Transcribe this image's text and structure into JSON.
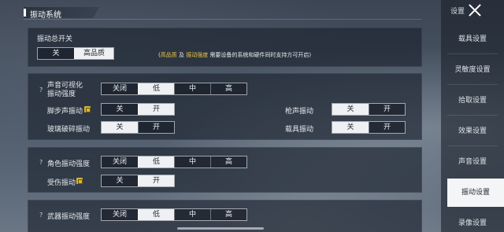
{
  "header": {
    "title": "振动系统"
  },
  "nav": {
    "top_label": "设置",
    "items": [
      "载具设置",
      "灵敏度设置",
      "拾取设置",
      "效果设置",
      "声音设置",
      "振动设置",
      "录像设置"
    ],
    "active": "振动设置"
  },
  "master": {
    "label": "振动总开关",
    "options": [
      "关",
      "高品质"
    ],
    "selected": "高品质",
    "note_open": "(",
    "note_hl1": "高品质",
    "note_mid1": "及",
    "note_hl2": "振动强度",
    "note_rest": "需要设备的系统和硬件同时支持方可开启)"
  },
  "sound": {
    "question": "?",
    "visual_label_line1": "声音可视化",
    "visual_label_line2": "振动强度",
    "intensity_options": [
      "关闭",
      "低",
      "中",
      "高"
    ],
    "intensity_selected": "低",
    "footstep_label": "脚步声振动",
    "footstep_options": [
      "关",
      "开"
    ],
    "footstep_selected": "开",
    "gunshot_label": "枪声振动",
    "gunshot_options": [
      "关",
      "开"
    ],
    "gunshot_selected": "关",
    "glass_label": "玻璃破碎振动",
    "glass_options": [
      "关",
      "开"
    ],
    "glass_selected": "关",
    "vehicle_label": "载具振动",
    "vehicle_options": [
      "关",
      "开"
    ],
    "vehicle_selected": "关"
  },
  "character": {
    "question": "?",
    "label": "角色振动强度",
    "options": [
      "关闭",
      "低",
      "中",
      "高"
    ],
    "selected": "低",
    "hurt_label": "受伤振动",
    "hurt_options": [
      "关",
      "开"
    ],
    "hurt_selected": "开"
  },
  "weapon": {
    "question": "?",
    "label": "武器振动强度",
    "options": [
      "关闭",
      "低",
      "中",
      "高"
    ],
    "selected": "低"
  },
  "colors": {
    "accent_yellow": "#e9c43e",
    "selected_bg": "#eef0f3",
    "card_bg": "#1e2530"
  }
}
